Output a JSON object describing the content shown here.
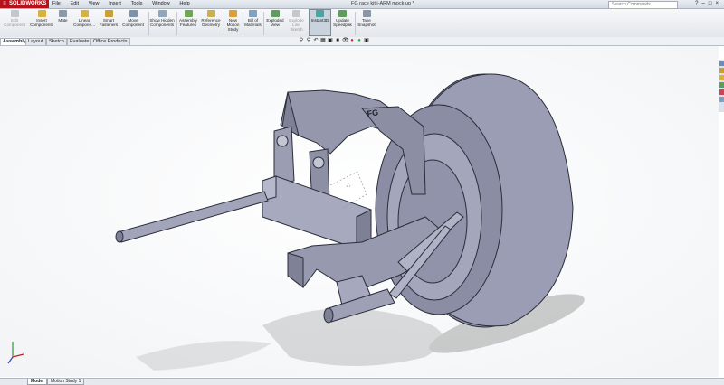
{
  "app": {
    "logo_text": "SOLIDWORKS",
    "document_title": "FG race kit i-ARM mock up *"
  },
  "menus": [
    "File",
    "Edit",
    "View",
    "Insert",
    "Tools",
    "Window",
    "Help"
  ],
  "search": {
    "placeholder": "Search Commands"
  },
  "commands": [
    {
      "label": "Edit Component",
      "icon": "edit-component-icon",
      "color": "#b9bec6"
    },
    {
      "label": "Insert Components",
      "icon": "insert-components-icon",
      "color": "#d9b23a"
    },
    {
      "label": "Mate",
      "icon": "mate-icon",
      "color": "#8a9aa8"
    },
    {
      "label": "Linear Compone...",
      "icon": "linear-pattern-icon",
      "color": "#d9b23a"
    },
    {
      "label": "Smart Fasteners",
      "icon": "smart-fasteners-icon",
      "color": "#c9a038"
    },
    {
      "label": "Move Component",
      "icon": "move-component-icon",
      "color": "#7d93ad"
    },
    {
      "label": "Show Hidden Components",
      "icon": "show-hidden-icon",
      "color": "#8fa6bd"
    },
    {
      "label": "Assembly Features",
      "icon": "assembly-features-icon",
      "color": "#6ea653"
    },
    {
      "label": "Reference Geometry",
      "icon": "reference-geometry-icon",
      "color": "#c9b24e"
    },
    {
      "label": "New Motion Study",
      "icon": "motion-study-icon",
      "color": "#e0a030"
    },
    {
      "label": "Bill of Materials",
      "icon": "bom-icon",
      "color": "#7fa2c4"
    },
    {
      "label": "Exploded View",
      "icon": "exploded-view-icon",
      "color": "#5f9d5f"
    },
    {
      "label": "Explode Line Sketch",
      "icon": "explode-line-icon",
      "color": "#b9bec6"
    },
    {
      "label": "Instant3D",
      "icon": "instant3d-icon",
      "color": "#48a6a0"
    },
    {
      "label": "Update Speedpak",
      "icon": "speedpak-icon",
      "color": "#5f9d5f"
    },
    {
      "label": "Take Snapshot",
      "icon": "snapshot-icon",
      "color": "#8a96a6"
    }
  ],
  "tabs": [
    "Assembly",
    "Layout",
    "Sketch",
    "Evaluate",
    "Office Products"
  ],
  "bottom_tabs": [
    "Model",
    "Motion Study 1"
  ],
  "model_label": "FG"
}
